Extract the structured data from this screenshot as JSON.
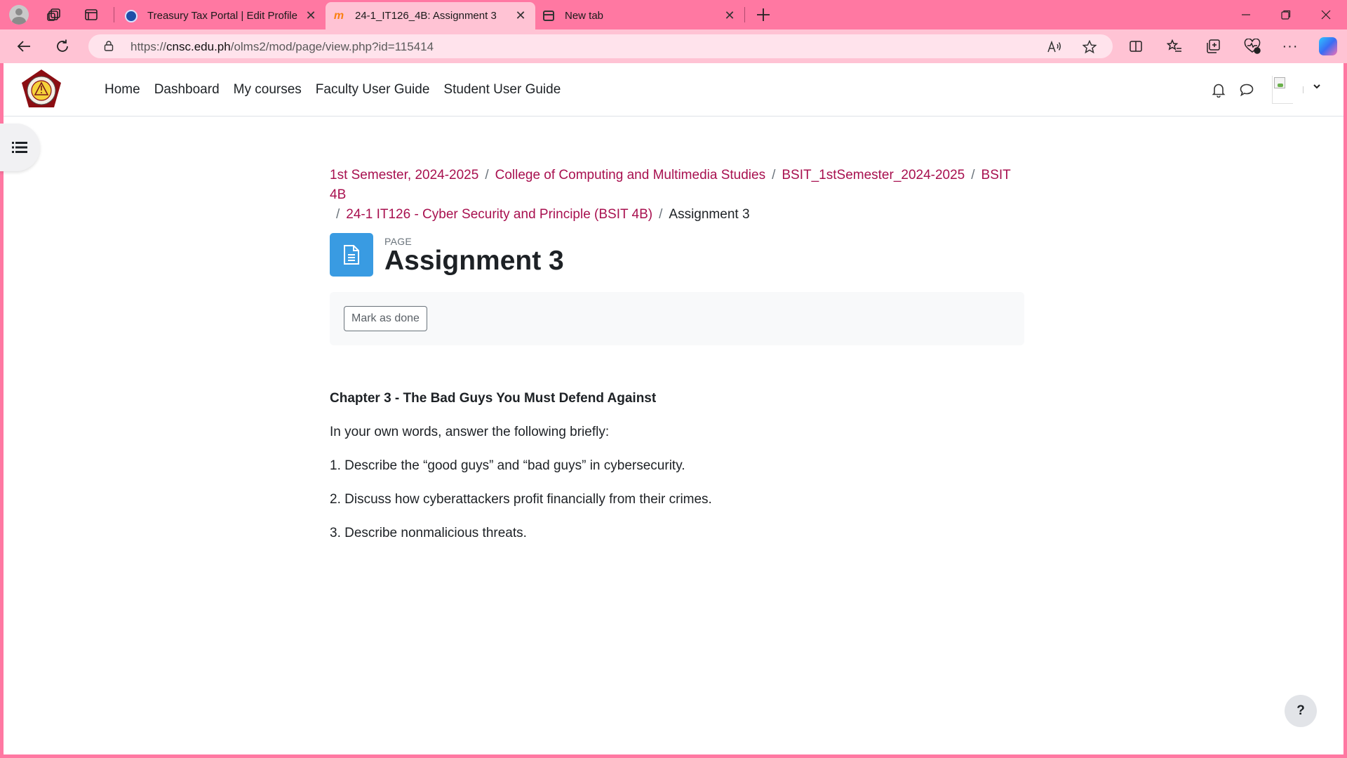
{
  "browser": {
    "tabs": [
      {
        "title": "Treasury Tax Portal | Edit Profile",
        "favicon": "treasury-favicon",
        "active": false
      },
      {
        "title": "24-1_IT126_4B: Assignment 3",
        "favicon": "moodle-favicon",
        "active": true
      },
      {
        "title": "New tab",
        "favicon": "newtab-favicon",
        "active": false
      }
    ],
    "address": {
      "url_prefix": "https://",
      "url_host": "cnsc.edu.ph",
      "url_path": "/olms2/mod/page/view.php?id=115414"
    },
    "accent_color": "#ff78a2"
  },
  "site": {
    "nav": [
      "Home",
      "Dashboard",
      "My courses",
      "Faculty User Guide",
      "Student User Guide"
    ]
  },
  "breadcrumb": {
    "items": [
      "1st Semester, 2024-2025",
      "College of Computing and Multimedia Studies",
      "BSIT_1stSemester_2024-2025",
      "BSIT 4B",
      "24-1 IT126 - Cyber Security and Principle (BSIT 4B)"
    ],
    "current": "Assignment 3",
    "separator": "/"
  },
  "activity": {
    "type_label": "PAGE",
    "title": "Assignment 3",
    "icon": "page-document-icon",
    "icon_color": "#399be2"
  },
  "completion": {
    "button_label": "Mark as done"
  },
  "content": {
    "heading": "Chapter 3 - The Bad Guys You Must Defend Against",
    "intro": "In your own words, answer the following briefly:",
    "questions": [
      "1. Describe the “good guys” and “bad guys” in cybersecurity.",
      "2. Discuss how cyberattackers profit financially from their crimes.",
      "3. Describe nonmalicious threats."
    ]
  },
  "help": {
    "label": "?"
  }
}
